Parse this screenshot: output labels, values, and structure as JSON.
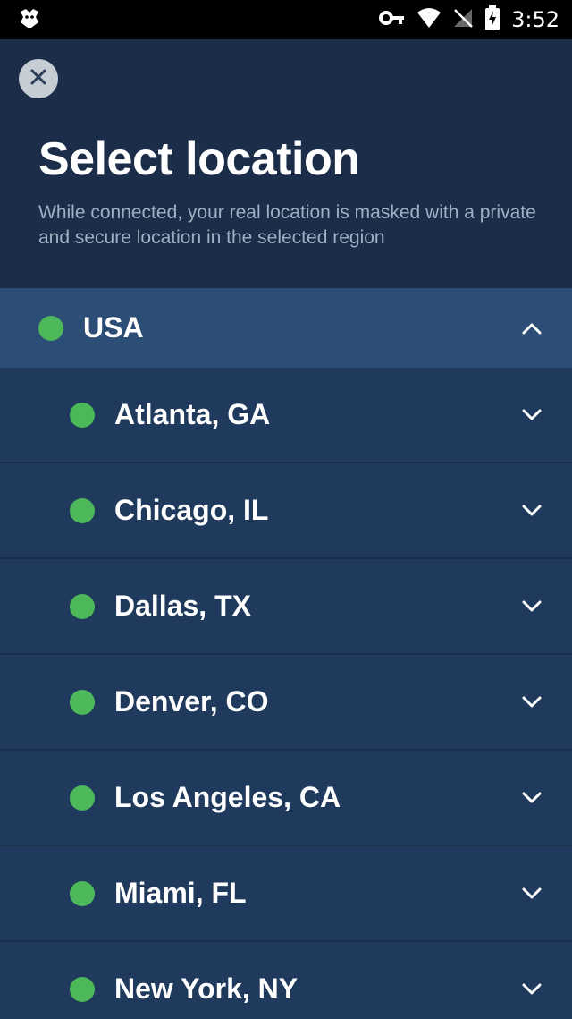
{
  "status_bar": {
    "time": "3:52",
    "icons": [
      "app-notification-icon",
      "vpn-key-icon",
      "wifi-icon",
      "no-signal-icon",
      "battery-charging-icon"
    ]
  },
  "header": {
    "close_icon": "close-icon",
    "title": "Select location",
    "subtitle": "While connected, your real location is masked with a private and secure location in the selected region"
  },
  "colors": {
    "status_online": "#4cb85a",
    "header_bg": "#1b2d48",
    "country_row_bg": "#2c4e76",
    "city_row_bg": "#1f3a5c"
  },
  "country": {
    "label": "USA",
    "expanded": true
  },
  "cities": [
    {
      "label": "Atlanta, GA"
    },
    {
      "label": "Chicago, IL"
    },
    {
      "label": "Dallas, TX"
    },
    {
      "label": "Denver, CO"
    },
    {
      "label": "Los Angeles, CA"
    },
    {
      "label": "Miami, FL"
    },
    {
      "label": "New York, NY"
    }
  ]
}
